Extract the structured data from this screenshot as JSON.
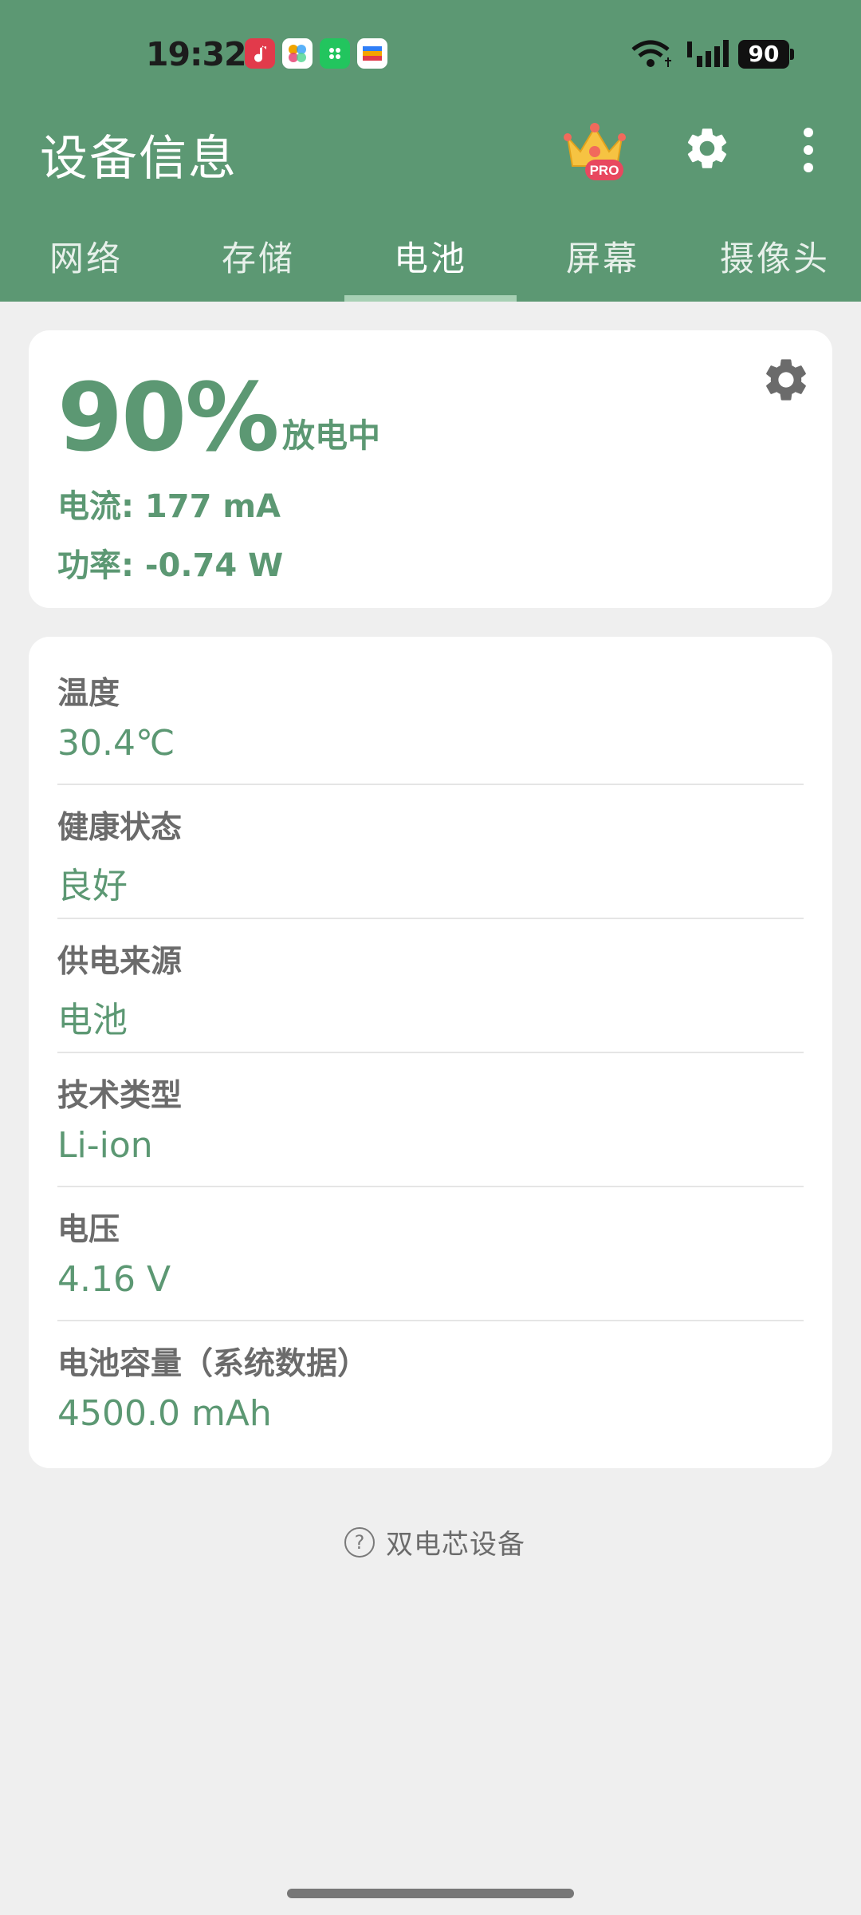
{
  "status_bar": {
    "time": "19:32",
    "battery_level": "90",
    "apps": [
      "music-app-icon",
      "photos-app-icon",
      "store-app-icon",
      "wallet-app-icon"
    ]
  },
  "app_bar": {
    "title": "设备信息",
    "icons": [
      "pro-crown-icon",
      "gear-icon",
      "more-vert-icon"
    ],
    "pro_badge": "PRO"
  },
  "tabs": [
    {
      "label": "网络",
      "active": false
    },
    {
      "label": "存储",
      "active": false
    },
    {
      "label": "电池",
      "active": true
    },
    {
      "label": "屏幕",
      "active": false
    },
    {
      "label": "摄像头",
      "active": false
    }
  ],
  "battery_summary": {
    "percent": "90%",
    "state": "放电中",
    "current": "电流: 177 mA",
    "power": "功率: -0.74 W"
  },
  "details": [
    {
      "label": "温度",
      "value": "30.4℃"
    },
    {
      "label": "健康状态",
      "value": "良好"
    },
    {
      "label": "供电来源",
      "value": "电池"
    },
    {
      "label": "技术类型",
      "value": "Li-ion"
    },
    {
      "label": "电压",
      "value": "4.16 V"
    },
    {
      "label": "电池容量（系统数据）",
      "value": "4500.0 mAh"
    }
  ],
  "footer": {
    "dual_cell_text": "双电芯设备",
    "help_symbol": "?"
  },
  "colors": {
    "primary": "#5c9873",
    "tab_indicator": "#a7d0b4",
    "background": "#efefef"
  }
}
